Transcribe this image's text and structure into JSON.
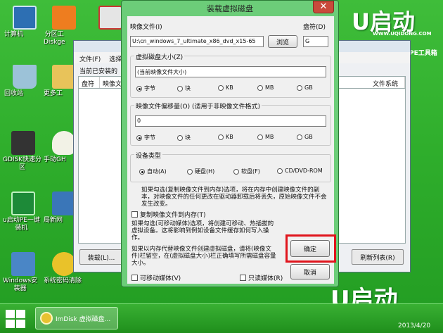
{
  "desktop": {
    "icons": [
      "计算机",
      "分区工\nDiskge",
      "",
      "回收站",
      "更多工",
      "GDISK快速分\n区",
      "手动GH",
      "u启动PE一键\n装机",
      "局新网",
      "Windows安\n装器",
      "系统密码清除"
    ],
    "brand_text": "U启动",
    "brand_small": "WWW.UQIDONG.COM",
    "brand_pe": "PE工具箱"
  },
  "bg_window": {
    "menu": [
      "文件(F)",
      "选择"
    ],
    "status": "当前已安装的",
    "columns": [
      "盘符",
      "映像文件",
      "文件系统"
    ],
    "buttons": {
      "load": "装载(L)...",
      "refresh": "刷新列表(R)"
    }
  },
  "dialog": {
    "title": "装载虚拟磁盘",
    "close": "✕",
    "image_file_label": "映像文件(I)",
    "image_file_value": "U:\\cn_windows_7_ultimate_x86_dvd_x15-65",
    "browse": "浏览",
    "drive_label": "盘符(D)",
    "drive_value": "G",
    "size_group": "虚拟磁盘大小(Z)",
    "size_value": "(当前映像文件大小)",
    "units": [
      "字节",
      "块",
      "KB",
      "MB",
      "GB"
    ],
    "offset_group": "映像文件偏移量(O) (适用于非映像文件格式)",
    "offset_value": "0",
    "device_group": "设备类型",
    "devices": [
      "自动(A)",
      "硬盘(H)",
      "软盘(F)",
      "CD/DVD-ROM"
    ],
    "para1": "如果勾选(复制映像文件到内存)选项，将在内存中创建映像文件的副本，对映像文件的任何更改在驱动器卸载后将丢失，原始映像文件不会发生改变。",
    "copy_to_mem": "复制映像文件到内存(T)",
    "para2": "如果勾选(可移动媒体)选项，将创建可移动、热插拔的虚拟设备。这将影响到例如设备文件缓存如何写入操作。",
    "para3": "如果以内存代替映像文件创建虚拟磁盘，请将(映像文件)栏留空，在(虚拟磁盘大小)栏正确填写所需磁盘容量大小。",
    "removable": "可移动媒体(V)",
    "readonly": "只读媒体(R)",
    "ok": "确定",
    "cancel": "取消"
  },
  "taskbar": {
    "app_label": "ImDisk 虚拟磁盘...",
    "date": "2013/4/20"
  }
}
